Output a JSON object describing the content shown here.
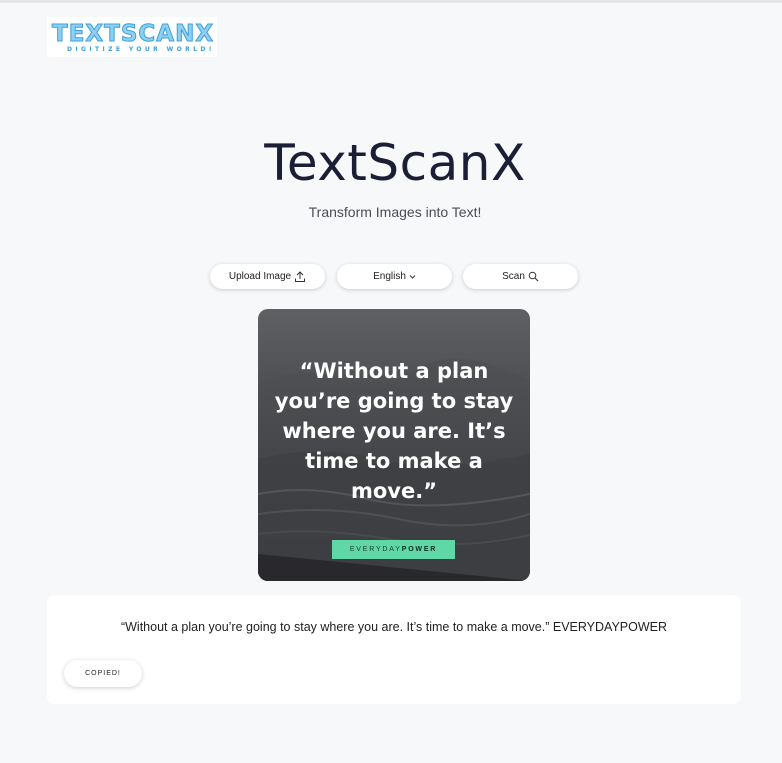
{
  "header": {
    "logo_word": "TEXTSCANX",
    "logo_tagline": "DIGITIZE YOUR WORLD!"
  },
  "hero": {
    "title": "TextScanX",
    "subtitle": "Transform Images into Text!"
  },
  "toolbar": {
    "upload_label": "Upload Image",
    "upload_icon": "upload-icon",
    "language_label": "English",
    "language_icon": "chevron-down-icon",
    "scan_label": "Scan",
    "scan_icon": "search-icon"
  },
  "image_preview": {
    "quote_text": "“Without a plan you’re going to stay where you are. It’s time to make a move.”",
    "brand_light": "EVERYDAY",
    "brand_bold": "POWER",
    "badge_color": "#5fd7a6"
  },
  "result": {
    "extracted_text": "“Without a plan you’re going to stay where you are. It’s time to make a move.” EVERYDAYPOWER",
    "copy_label": "COPIED!"
  }
}
